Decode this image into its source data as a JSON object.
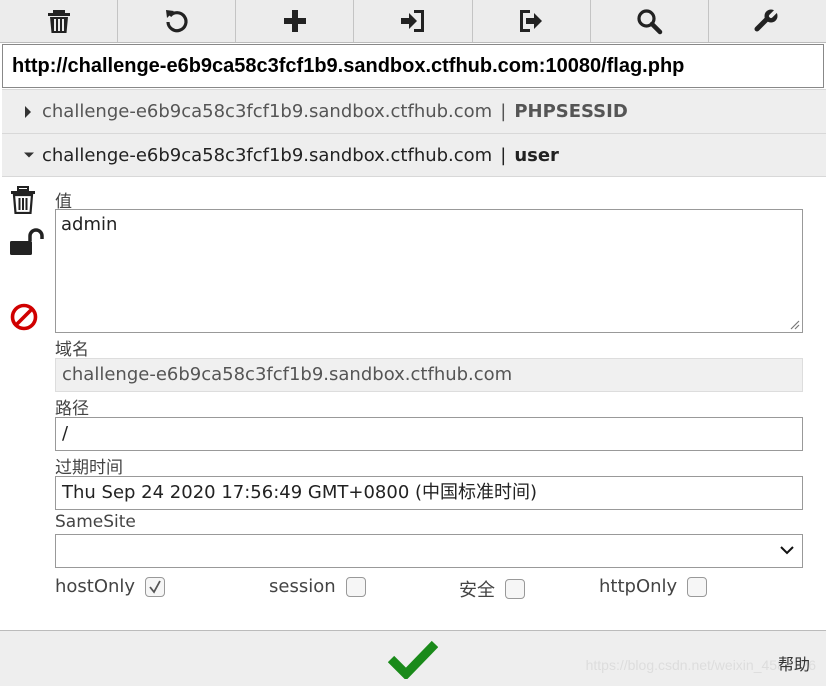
{
  "toolbar": {
    "buttons": [
      {
        "icon": "trash-icon"
      },
      {
        "icon": "refresh-icon"
      },
      {
        "icon": "plus-icon"
      },
      {
        "icon": "import-icon"
      },
      {
        "icon": "export-icon"
      },
      {
        "icon": "search-icon"
      },
      {
        "icon": "wrench-icon"
      }
    ]
  },
  "url": "http://challenge-e6b9ca58c3fcf1b9.sandbox.ctfhub.com:10080/flag.php",
  "cookies": [
    {
      "domain": "challenge-e6b9ca58c3fcf1b9.sandbox.ctfhub.com",
      "sep": "|",
      "name": "PHPSESSID",
      "expanded": false
    },
    {
      "domain": "challenge-e6b9ca58c3fcf1b9.sandbox.ctfhub.com",
      "sep": "|",
      "name": "user",
      "expanded": true
    }
  ],
  "editor": {
    "value_label": "值",
    "value": "admin",
    "domain_label": "域名",
    "domain": "challenge-e6b9ca58c3fcf1b9.sandbox.ctfhub.com",
    "path_label": "路径",
    "path": "/",
    "expires_label": "过期时间",
    "expires": "Thu Sep 24 2020 17:56:49 GMT+0800 (中国标准时间)",
    "samesite_label": "SameSite",
    "samesite": "",
    "checkboxes": [
      {
        "label": "hostOnly",
        "checked": true
      },
      {
        "label": "session",
        "checked": false
      },
      {
        "label": "安全",
        "checked": false
      },
      {
        "label": "httpOnly",
        "checked": false
      }
    ]
  },
  "footer": {
    "help": "帮助",
    "watermark": "https://blog.csdn.net/weixin_4586126",
    "save_icon": "checkmark-icon"
  },
  "colors": {
    "delete_red": "#d00000",
    "save_green": "#1a8a1a"
  }
}
